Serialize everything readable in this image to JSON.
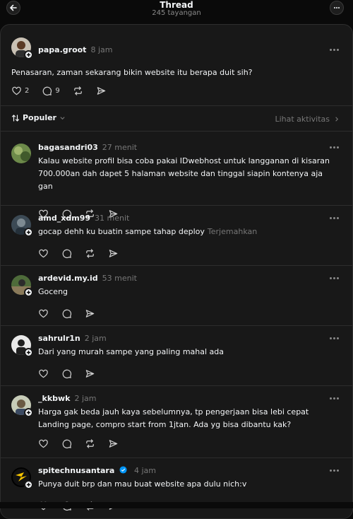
{
  "header": {
    "title": "Thread",
    "subtitle": "245 tayangan",
    "back_icon": "arrow-left-icon",
    "menu_icon": "ellipsis-icon"
  },
  "main_post": {
    "username": "papa.groot",
    "time": "8 jam",
    "text": "Penasaran, zaman sekarang bikin website itu berapa duit sih?",
    "likes": "2",
    "comments": "9"
  },
  "sort": {
    "label": "Populer",
    "activity_link": "Lihat aktivitas"
  },
  "replies": [
    {
      "username": "bagasandri03",
      "time": "27 menit",
      "lines": [
        "Kalau website profil bisa coba pakai IDwebhost untuk langganan di kisaran",
        "700.000an dah dapet 5 halaman website dan tinggal siapin kontenya aja gan"
      ]
    },
    {
      "username": "amd_xdm99",
      "time": "31 menit",
      "lines": [
        "gocap dehh ku buatin sampe tahap deploy"
      ],
      "translate": "Terjemahkan"
    },
    {
      "username": "ardevid.my.id",
      "time": "53 menit",
      "lines": [
        "Goceng"
      ]
    },
    {
      "username": "sahrulr1n",
      "time": "2 jam",
      "lines": [
        "Dari yang murah sampe yang paling mahal ada"
      ]
    },
    {
      "username": "_kkbwk",
      "time": "2 jam",
      "lines": [
        "Harga gak beda jauh kaya sebelumnya, tp pengerjaan bisa lebi cepat",
        "Landing page, compro start from 1jtan. Ada yg bisa dibantu kak?"
      ]
    },
    {
      "username": "spitechnusantara",
      "time": "4 jam",
      "lines": [
        "Punya duit brp dan mau buat website apa dulu nich:v"
      ],
      "verified": true
    }
  ],
  "colors": {
    "background": "#0a0a0a",
    "panel": "#181818",
    "border": "#2d2d2d",
    "verified": "#0095f6"
  }
}
